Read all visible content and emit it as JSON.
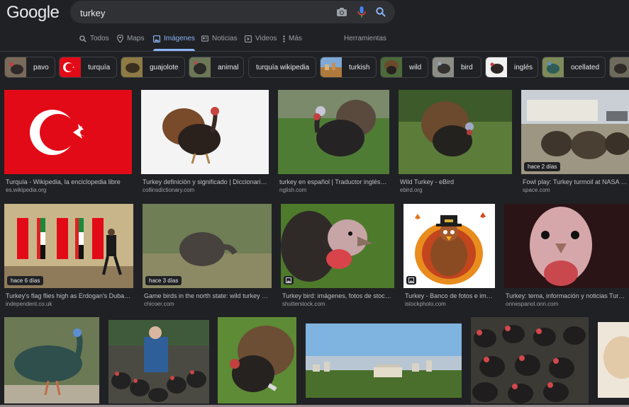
{
  "header": {
    "logo": "Google",
    "search": {
      "value": "turkey",
      "camera_icon": "camera-icon",
      "mic_icon": "microphone-icon",
      "search_icon": "search-icon"
    }
  },
  "tabs": [
    {
      "label": "Todos",
      "icon": "search-icon"
    },
    {
      "label": "Maps",
      "icon": "map-pin-icon"
    },
    {
      "label": "Imágenes",
      "icon": "image-icon"
    },
    {
      "label": "Noticias",
      "icon": "news-icon"
    },
    {
      "label": "Videos",
      "icon": "play-icon"
    },
    {
      "label": "Más",
      "icon": "more-icon"
    },
    {
      "label": "Herramientas"
    }
  ],
  "chips": [
    {
      "label": "pavo"
    },
    {
      "label": "turquía"
    },
    {
      "label": "guajolote"
    },
    {
      "label": "animal"
    },
    {
      "label": "turquía wikipedia"
    },
    {
      "label": "turkish"
    },
    {
      "label": "wild"
    },
    {
      "label": "bird"
    },
    {
      "label": "inglés"
    },
    {
      "label": "ocellated"
    }
  ],
  "results": {
    "row1": [
      {
        "title": "Turquía - Wikipedia, la enciclopedia libre",
        "source": "es.wikipedia.org"
      },
      {
        "title": "Turkey definición y significado | Diccionario I...",
        "source": "collinsdictionary.com"
      },
      {
        "title": "turkey en español | Traductor inglés-es...",
        "source": "nglish.com"
      },
      {
        "title": "Wild Turkey - eBird",
        "source": "ebird.org"
      },
      {
        "title": "Fowl play: Turkey turmoil at NASA cente",
        "source": "space.com",
        "badge": "hace 2 días"
      }
    ],
    "row2": [
      {
        "title": "Turkey's flag flies high as Erdogan's Dubai trip ...",
        "source": "independent.co.uk",
        "badge": "hace 6 días"
      },
      {
        "title": "Game birds in the north state: wild turkey and ...",
        "source": "chicoer.com",
        "badge": "hace 3 días"
      },
      {
        "title": "Turkey bird: imágenes, fotos de stock y v...",
        "source": "shutterstock.com"
      },
      {
        "title": "Turkey - Banco de fotos e imáge...",
        "source": "istockphoto.com"
      },
      {
        "title": "Turkey: tema, información y noticias Turke...",
        "source": "onnespanol.onn.com"
      }
    ]
  }
}
